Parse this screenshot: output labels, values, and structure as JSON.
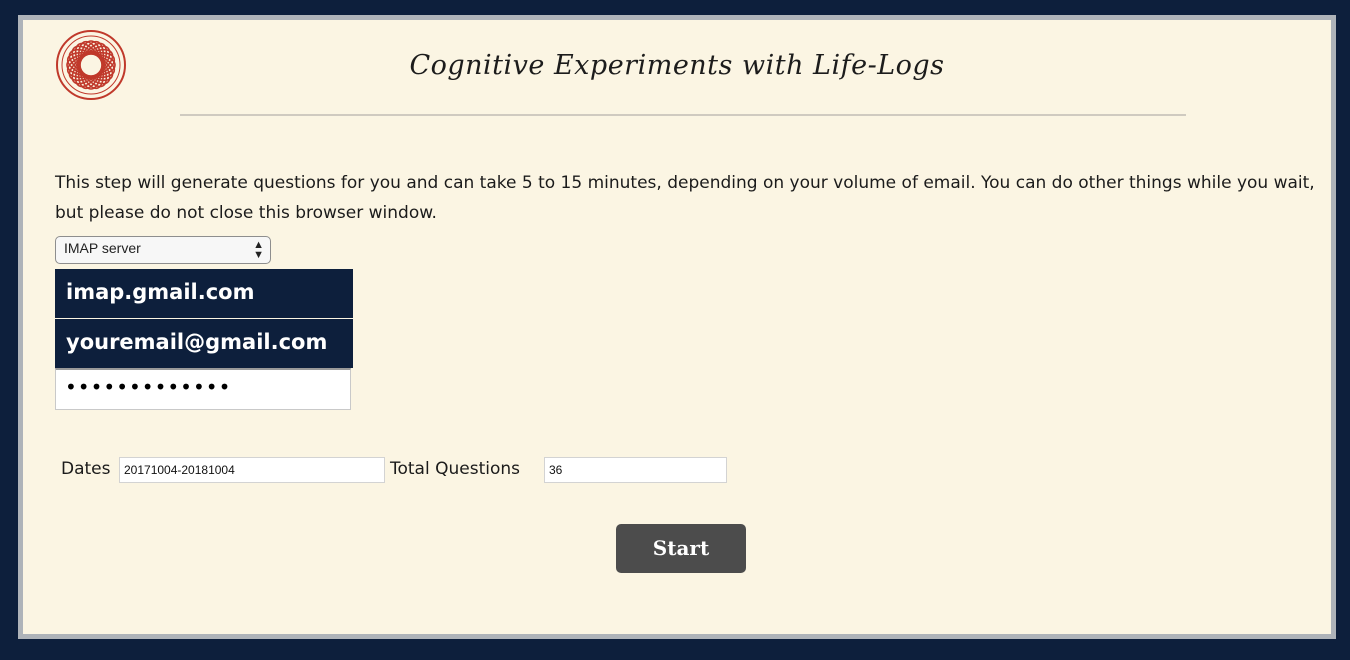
{
  "header": {
    "title": "Cognitive Experiments with Life-Logs",
    "logo_icon": "red-spiral-logo-icon"
  },
  "description": "This step will generate questions for you and can take 5 to 15 minutes, depending on your volume of email. You can do other things while you wait, but please do not close this browser window.",
  "form": {
    "server_type": {
      "selected": "IMAP server"
    },
    "host_value": "imap.gmail.com",
    "email_value": "youremail@gmail.com",
    "password_mask": "•••••••••••••",
    "dates_label": "Dates",
    "dates_value": "20171004-20181004",
    "total_label": "Total Questions",
    "total_value": "36",
    "start_label": "Start"
  },
  "colors": {
    "frame": "#0d1f3c",
    "panel": "#fbf5e3",
    "logo": "#c0392b",
    "button": "#4c4c4c"
  }
}
